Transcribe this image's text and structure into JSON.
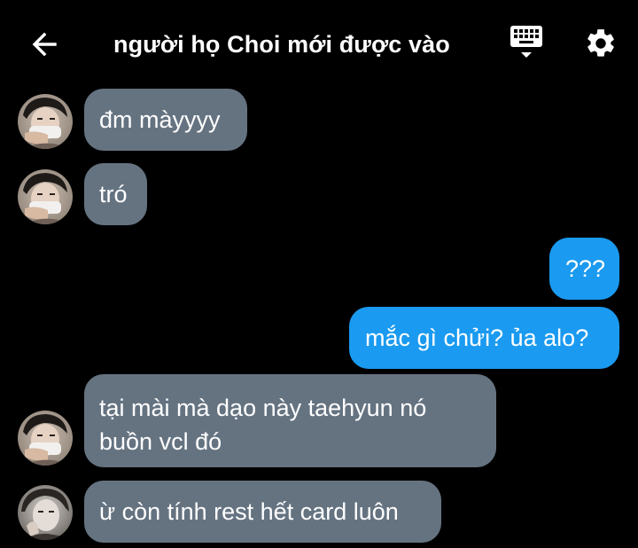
{
  "header": {
    "title": "người họ Choi mới được vào",
    "back_icon": "arrow-left-icon",
    "keyboard_icon": "keyboard-icon",
    "settings_icon": "gear-icon"
  },
  "colors": {
    "background": "#000000",
    "incoming_bubble": "#657381",
    "outgoing_bubble": "#1a9af0",
    "text": "#ffffff"
  },
  "messages": [
    {
      "direction": "incoming",
      "text": "đm màyyyy"
    },
    {
      "direction": "incoming",
      "text": "tró"
    },
    {
      "direction": "outgoing",
      "text": "???"
    },
    {
      "direction": "outgoing",
      "text": "mắc gì chửi? ủa alo?"
    },
    {
      "direction": "incoming",
      "text_line1": "tại mài mà dạo này taehyun nó",
      "text_line2": "buồn vcl đó"
    },
    {
      "direction": "incoming",
      "text": "ừ còn tính rest hết card luôn"
    }
  ]
}
